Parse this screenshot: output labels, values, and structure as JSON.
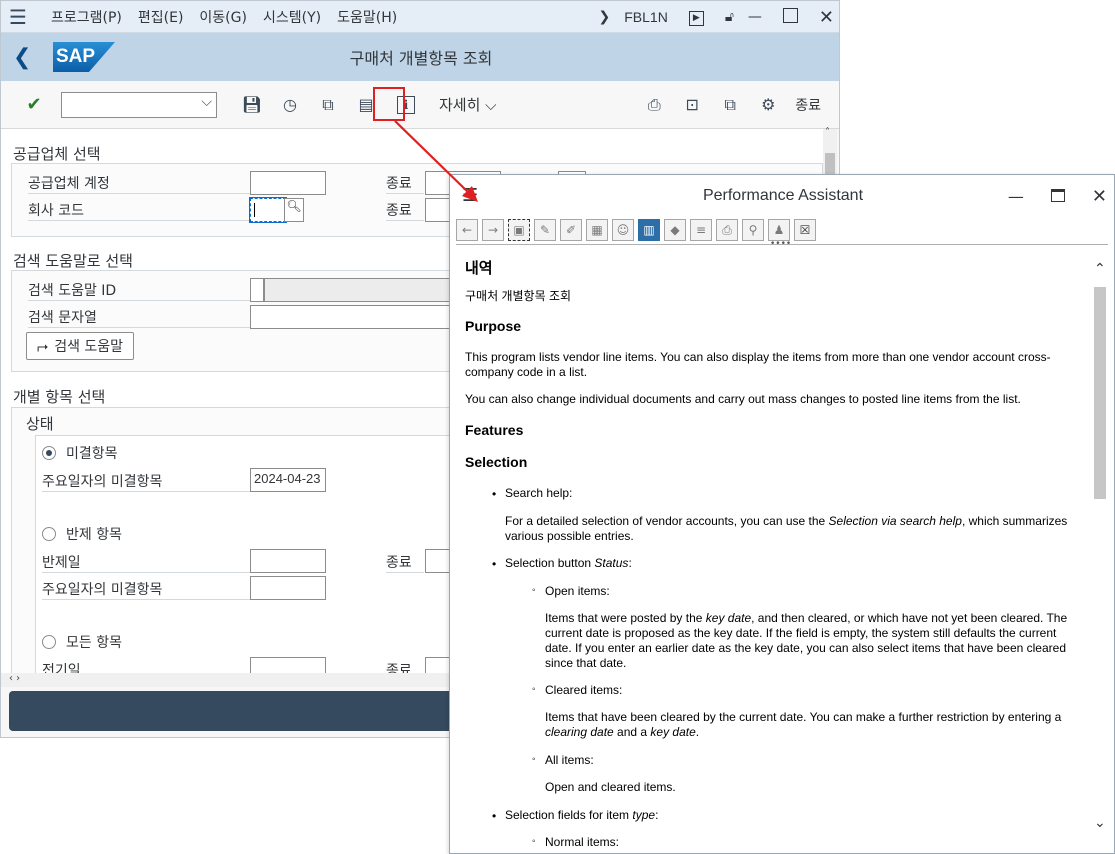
{
  "menubar": {
    "items": [
      "프로그램(P)",
      "편집(E)",
      "이동(G)",
      "시스템(Y)",
      "도움말(H)"
    ],
    "tcode": "FBL1N"
  },
  "title": "구매처 개별항목 조회",
  "logo": "SAP",
  "toolbar": {
    "details_label": "자세히",
    "exit_label": "종료"
  },
  "form": {
    "vendor_section": "공급업체 선택",
    "vendor_account": "공급업체 계정",
    "company_code": "회사 코드",
    "to_label": "종료",
    "search_section": "검색 도움말로 선택",
    "search_help_id": "검색 도움말 ID",
    "search_string": "검색 문자열",
    "search_help_button": "검색 도움말",
    "item_section": "개별 항목 선택",
    "status": "상태",
    "open_items": "미결항목",
    "open_at_key_date": "주요일자의 미결항목",
    "key_date_value": "2024-04-23",
    "cleared_items": "반제 항목",
    "clearing_date": "반제일",
    "open_at_key_date2": "주요일자의 미결항목",
    "all_items": "모든 항목",
    "posting_date": "전기일"
  },
  "assistant": {
    "window_title": "Performance Assistant",
    "heading_ko": "내역",
    "subtitle_ko": "구매처 개별항목 조회",
    "purpose": "Purpose",
    "purpose_p1": "This program lists vendor line items. You can also display the items from more than one vendor account cross-company code in a list.",
    "purpose_p2": "You can also change individual documents and carry out mass changes to posted line items from the list.",
    "features": "Features",
    "selection": "Selection",
    "search_help": "Search help:",
    "search_help_text_a": "For a detailed selection of vendor accounts, you can use the ",
    "search_help_text_em": "Selection via search help",
    "search_help_text_b": ", which summarizes various possible entries.",
    "sel_button_a": "Selection button ",
    "sel_button_em": "Status",
    "sel_button_b": ":",
    "open_items": "Open items:",
    "open_text_a": "Items that were posted by the ",
    "open_text_em1": "key date",
    "open_text_b": ", and then cleared, or which have not yet been cleared. The current date is proposed as the key date. If the field is empty, the system still defaults the current date. If you enter an earlier date as the key date, you can also select items that have been cleared since that date.",
    "cleared_items": "Cleared items:",
    "cleared_text_a": "Items that have been cleared by the current date. You can make a further restriction by entering a ",
    "cleared_text_em1": "clearing date",
    "cleared_text_b": " and a ",
    "cleared_text_em2": "key date",
    "cleared_text_c": ".",
    "all_items": "All items:",
    "all_text": "Open and cleared items.",
    "sel_fields_a": "Selection fields for item ",
    "sel_fields_em": "type",
    "sel_fields_b": ":",
    "normal_items": "Normal items:"
  },
  "colors": {
    "annotation": "#e02020",
    "sap_blue": "#0b5ea8",
    "footer": "#354a5f"
  }
}
